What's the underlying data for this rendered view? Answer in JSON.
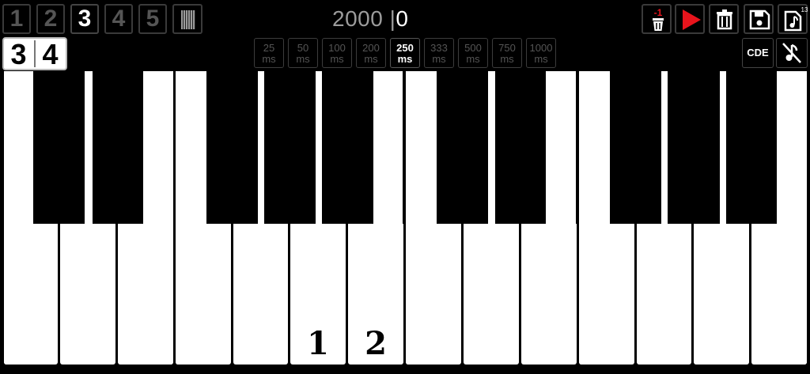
{
  "toolbar": {
    "octaves": [
      "1",
      "2",
      "3",
      "4",
      "5"
    ],
    "active_octave": "3",
    "counter_total": "2000",
    "counter_sep": "|",
    "counter_current": "0",
    "undo_badge": "-1",
    "song_badge": "13"
  },
  "time_signature": {
    "top": "3",
    "bottom": "4"
  },
  "ms_options": [
    {
      "value": "25",
      "unit": "ms"
    },
    {
      "value": "50",
      "unit": "ms"
    },
    {
      "value": "100",
      "unit": "ms"
    },
    {
      "value": "200",
      "unit": "ms"
    },
    {
      "value": "250",
      "unit": "ms"
    },
    {
      "value": "333",
      "unit": "ms"
    },
    {
      "value": "500",
      "unit": "ms"
    },
    {
      "value": "750",
      "unit": "ms"
    },
    {
      "value": "1000",
      "unit": "ms"
    }
  ],
  "active_ms": "250",
  "cde_label": "CDE",
  "keys": {
    "label_1": "1",
    "label_2": "2"
  },
  "colors": {
    "accent_red": "#e8141c",
    "background": "#000000",
    "inactive": "#555555"
  },
  "icons": [
    "piano-icon",
    "clear-last-icon",
    "play-icon",
    "trash-icon",
    "save-icon",
    "song-icon",
    "mute-note-icon"
  ]
}
